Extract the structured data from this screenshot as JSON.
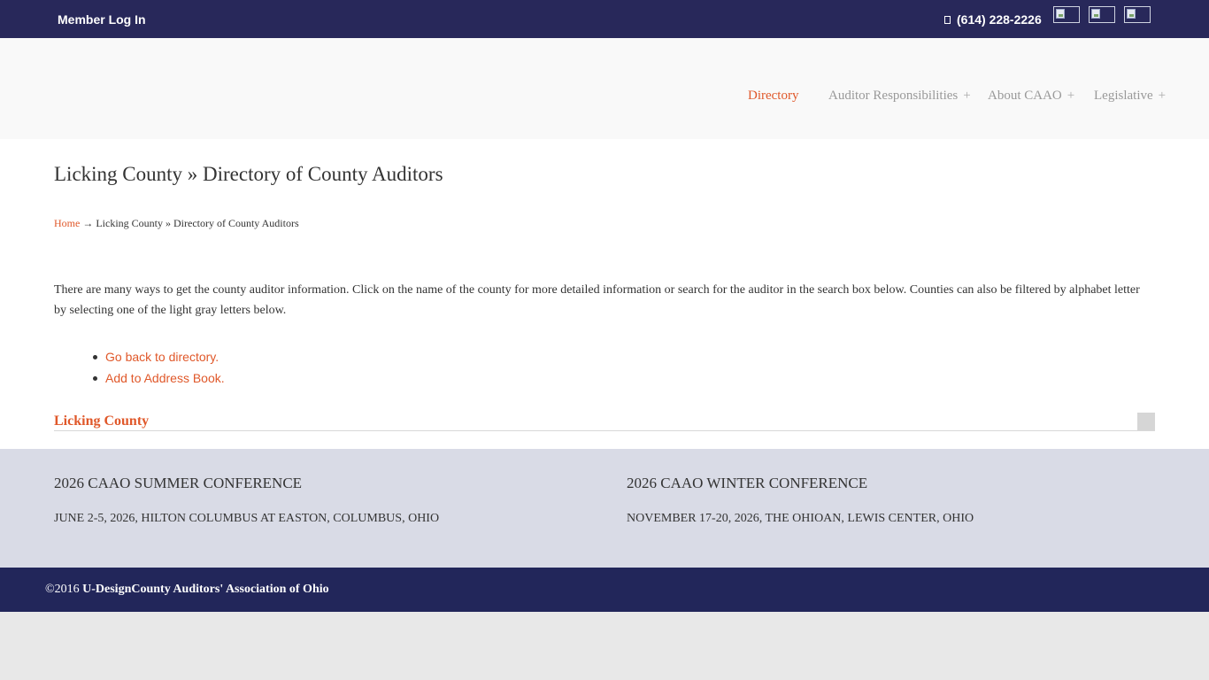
{
  "topbar": {
    "member_login": "Member Log In",
    "phone": "(614) 228-2226",
    "phone_icon": "phone-icon",
    "social_icons": [
      "broken-image-icon",
      "broken-image-icon",
      "broken-image-icon"
    ]
  },
  "nav": {
    "items": [
      {
        "label": "Directory",
        "plus": ""
      },
      {
        "label": "Auditor Responsibilities",
        "plus": "+"
      },
      {
        "label": "About CAAO",
        "plus": "+"
      },
      {
        "label": "Legislative",
        "plus": "+"
      }
    ]
  },
  "main": {
    "title": "Licking County » Directory of County Auditors",
    "breadcrumb": {
      "home": "Home",
      "separator": " → ",
      "current": "Licking County » Directory of County Auditors"
    },
    "intro": "There are many ways to get the county auditor information. Click on the name of the county for more detailed information or search for the auditor in the search box below. Counties can also be filtered by alphabet letter by selecting one of the light gray letters below.",
    "links": [
      "Go back to directory.",
      "Add to Address Book."
    ],
    "county": "Licking County"
  },
  "conferences": [
    {
      "title": "2026 CAAO SUMMER CONFERENCE",
      "detail": "JUNE 2-5, 2026, HILTON COLUMBUS AT EASTON, COLUMBUS, OHIO"
    },
    {
      "title": "2026 CAAO WINTER CONFERENCE",
      "detail": "NOVEMBER 17-20, 2026, THE OHIOAN, LEWIS CENTER, OHIO"
    }
  ],
  "footer": {
    "copyright_prefix": "©2016 ",
    "copyright_bold": "U-DesignCounty Auditors' Association of Ohio"
  },
  "colors": {
    "topbar": "#28285a",
    "accent": "#e0582a",
    "conference_band": "#d9dbe6",
    "footer": "#22265a"
  }
}
